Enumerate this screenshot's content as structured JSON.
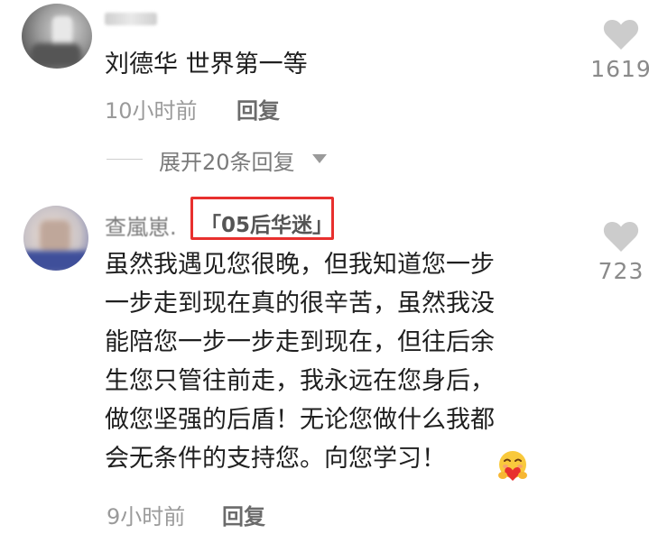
{
  "comments": [
    {
      "text": "刘德华 世界第一等",
      "time": "10小时前",
      "reply_label": "回复",
      "likes": "1619",
      "expand_label": "展开20条回复"
    },
    {
      "username": "查嵐崽.",
      "badge": "「05后华迷」",
      "lines": [
        "虽然我遇见您很晚，但我知道您一步",
        "一步走到现在真的很辛苦，虽然我没",
        "能陪您一步一步走到现在，但往后余",
        "生您只管往前走，我永远在您身后，",
        "做您坚强的后盾！无论您做什么我都",
        "会无条件的支持您。向您学习！"
      ],
      "time": "9小时前",
      "reply_label": "回复",
      "likes": "723"
    }
  ],
  "icons": {
    "like": "heart-icon",
    "expand": "caret-down-icon",
    "emoji": "hugging-face-emoji"
  },
  "colors": {
    "badge_border": "#e8302e",
    "heart": "#cccccc"
  }
}
